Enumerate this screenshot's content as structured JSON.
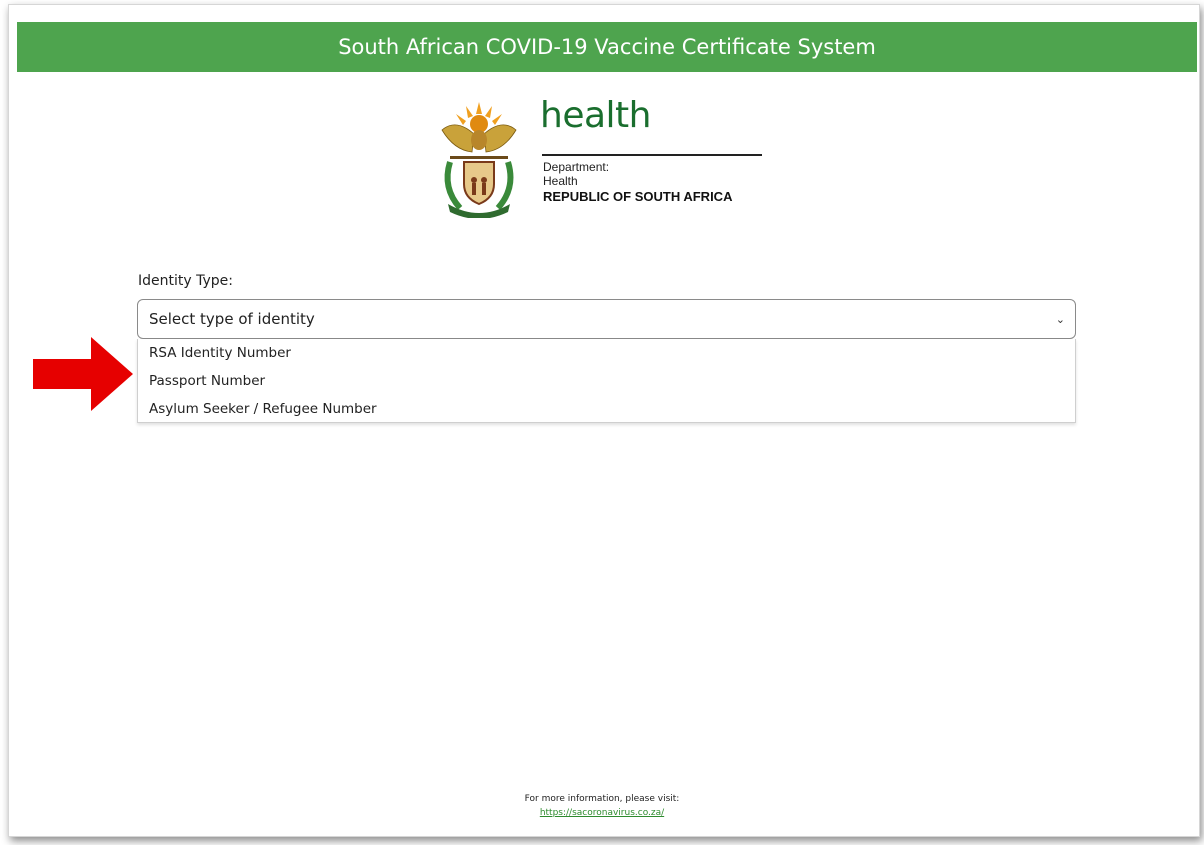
{
  "header": {
    "title": "South African COVID-19 Vaccine Certificate System",
    "color": "#4ea44e"
  },
  "logo": {
    "word": "health",
    "department": "Department:",
    "department_name": "Health",
    "republic": "REPUBLIC OF SOUTH AFRICA"
  },
  "form": {
    "identity_label": "Identity Type:",
    "select_value": "Select type of identity",
    "options": [
      "RSA Identity Number",
      "Passport Number",
      "Asylum Seeker / Refugee Number"
    ]
  },
  "annotation": {
    "arrow_color": "#e60000"
  },
  "footer": {
    "text": "For more information, please visit:",
    "link": "https://sacoronavirus.co.za/"
  }
}
